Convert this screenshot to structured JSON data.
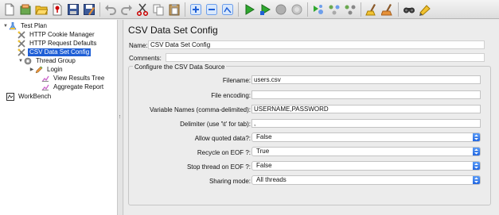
{
  "toolbar": {
    "buttons": [
      {
        "name": "new-icon"
      },
      {
        "name": "templates-icon"
      },
      {
        "name": "open-icon"
      },
      {
        "name": "close-icon"
      },
      {
        "name": "save-icon"
      },
      {
        "name": "save-as-icon"
      },
      {
        "name": "undo-icon"
      },
      {
        "name": "redo-icon"
      },
      {
        "name": "cut-icon"
      },
      {
        "name": "copy-icon"
      },
      {
        "name": "paste-icon"
      },
      {
        "name": "expand-icon"
      },
      {
        "name": "collapse-icon"
      },
      {
        "name": "toggle-icon"
      },
      {
        "name": "start-icon"
      },
      {
        "name": "start-no-pauses-icon"
      },
      {
        "name": "stop-icon"
      },
      {
        "name": "shutdown-icon"
      },
      {
        "name": "remote-start-icon"
      },
      {
        "name": "remote-stop-icon"
      },
      {
        "name": "remote-shutdown-icon"
      },
      {
        "name": "clear-icon"
      },
      {
        "name": "clear-all-icon"
      },
      {
        "name": "search-icon"
      },
      {
        "name": "reset-search-icon"
      }
    ]
  },
  "tree": {
    "items": [
      {
        "label": "Test Plan",
        "icon": "flask-icon",
        "toggle": "▼"
      },
      {
        "label": "HTTP Cookie Manager",
        "icon": "wrench-icon"
      },
      {
        "label": "HTTP Request Defaults",
        "icon": "wrench-icon"
      },
      {
        "label": "CSV Data Set Config",
        "icon": "wrench-icon",
        "selected": true
      },
      {
        "label": "Thread Group",
        "icon": "gear-icon",
        "toggle": "▼"
      },
      {
        "label": "Login",
        "icon": "pen-icon",
        "toggle": "▶"
      },
      {
        "label": "View Results Tree",
        "icon": "chart-icon"
      },
      {
        "label": "Aggregate Report",
        "icon": "chart-icon"
      },
      {
        "label": "WorkBench",
        "icon": "workbench-icon"
      }
    ]
  },
  "panel": {
    "title": "CSV Data Set Config",
    "name_label": "Name:",
    "name_value": "CSV Data Set Config",
    "comments_label": "Comments:",
    "comments_value": "",
    "group_title": "Configure the CSV Data Source",
    "filename_label": "Filename:",
    "filename_value": "users.csv",
    "encoding_label": "File encoding:",
    "encoding_value": "",
    "varnames_label": "Variable Names (comma-delimited):",
    "varnames_value": "USERNAME,PASSWORD",
    "delimiter_label": "Delimiter (use '\\t' for tab):",
    "delimiter_value": ",",
    "quoted_label": "Allow quoted data?:",
    "quoted_value": "False",
    "recycle_label": "Recycle on EOF ?:",
    "recycle_value": "True",
    "stopthread_label": "Stop thread on EOF ?:",
    "stopthread_value": "False",
    "sharing_label": "Sharing mode:",
    "sharing_value": "All threads"
  },
  "colors": {
    "selection": "#1f5fd6",
    "select_arrow": "#2367e0"
  }
}
